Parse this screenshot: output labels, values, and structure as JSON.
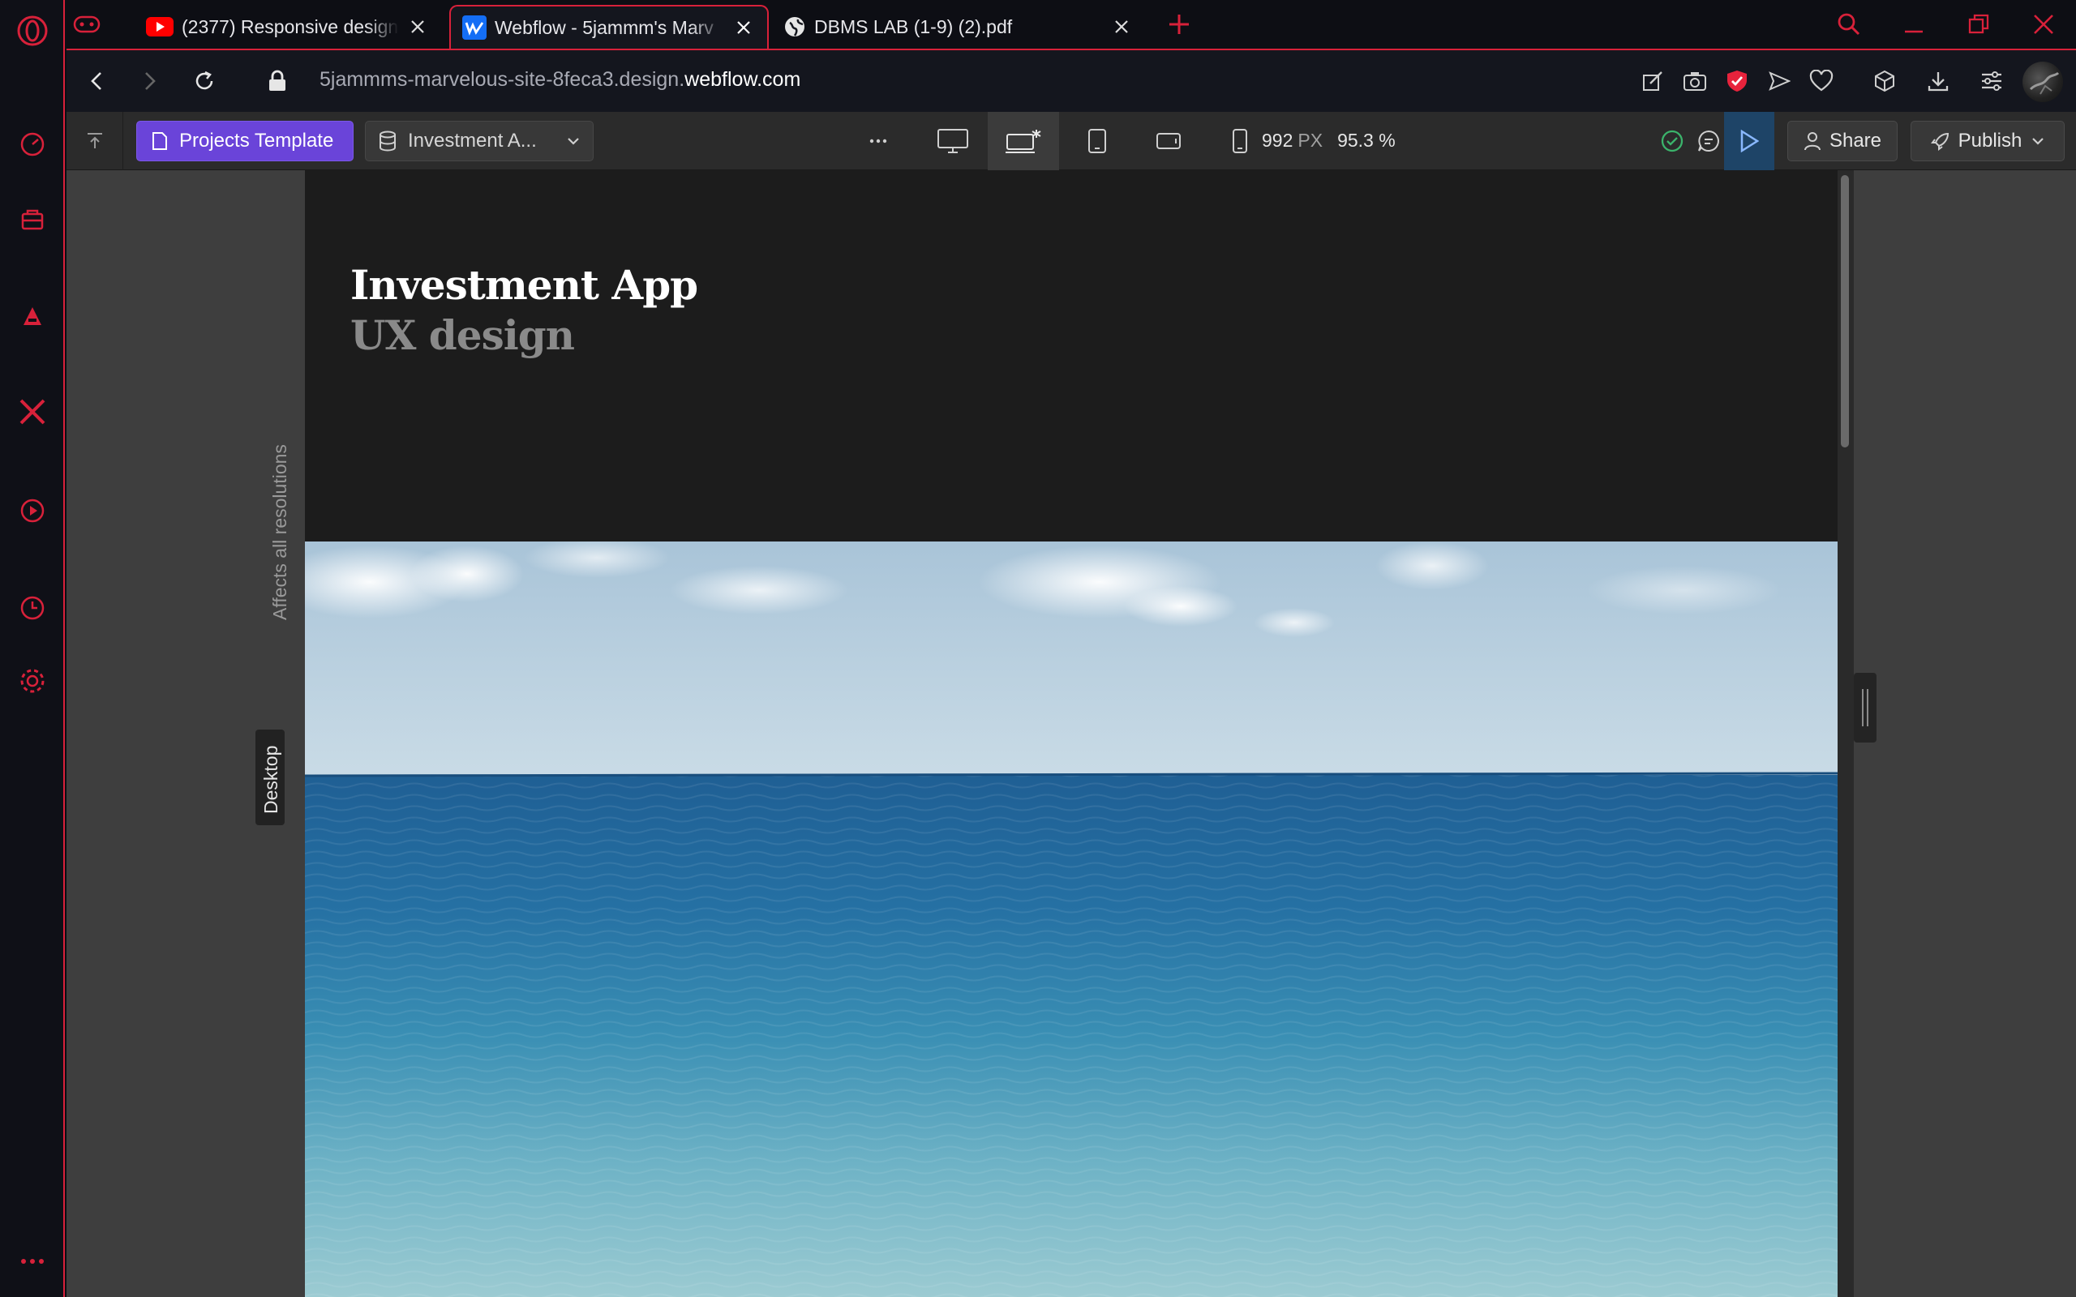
{
  "browser": {
    "tabs": [
      {
        "title": "(2377) Responsive design c",
        "favicon": "youtube-icon"
      },
      {
        "title": "Webflow - 5jammm's Marv",
        "favicon": "webflow-icon",
        "active": true
      },
      {
        "title": "DBMS LAB (1-9) (2).pdf",
        "favicon": "globe-icon"
      }
    ],
    "url_path": "5jammms-marvelous-site-8feca3.design.",
    "url_domain": "webflow.com",
    "accent": "#d8213a"
  },
  "webflow": {
    "page_label": "Projects Template",
    "cms_label": "Investment A...",
    "width_value": "992",
    "width_unit": "PX",
    "zoom": "95.3 %",
    "share_label": "Share",
    "publish_label": "Publish",
    "breakpoint_note": "Affects all resolutions",
    "breakpoint_name": "Desktop"
  },
  "page": {
    "title": "Investment App",
    "subtitle": "UX design"
  },
  "colors": {
    "purple": "#6a44d9",
    "preview_blue": "#1e4467",
    "frame_bg": "#1c1c1c"
  }
}
